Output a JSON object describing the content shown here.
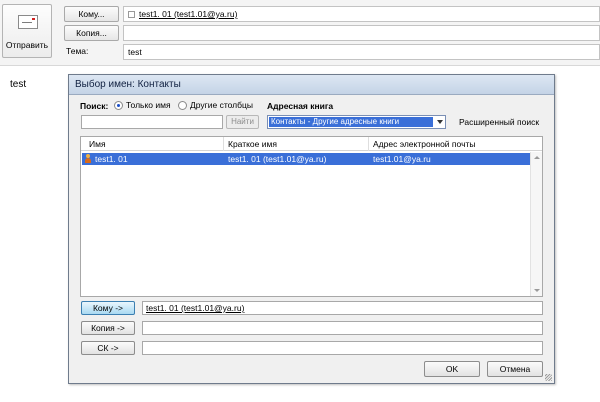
{
  "compose": {
    "send_label": "Отправить",
    "to_button": "Кому...",
    "to_value": "test1. 01 (test1.01@ya.ru)",
    "cc_button": "Копия...",
    "cc_value": "",
    "subject_label": "Тема:",
    "subject_value": "test",
    "body": "test"
  },
  "dialog": {
    "title": "Выбор имен: Контакты",
    "search_label": "Поиск:",
    "radio_name_only": "Только имя",
    "radio_other_columns": "Другие столбцы",
    "address_book_label": "Адресная книга",
    "search_value": "",
    "find_button": "Найти",
    "address_book_value": "Контакты - Другие адресные книги",
    "advanced_search": "Расширенный поиск",
    "columns": [
      "Имя",
      "Краткое имя",
      "Адрес электронной почты"
    ],
    "rows": [
      {
        "name": "test1. 01",
        "display": "test1. 01 (test1.01@ya.ru)",
        "email": "test1.01@ya.ru"
      }
    ],
    "to_button": "Кому ->",
    "to_value": "test1. 01 (test1.01@ya.ru)",
    "cc_button": "Копия ->",
    "cc_value": "",
    "bcc_button": "СК ->",
    "bcc_value": "",
    "ok_button": "OK",
    "cancel_button": "Отмена"
  },
  "colors": {
    "selection": "#3a6fd8",
    "title_bar": "#c4d3e6",
    "active_button": "#a9d9f2"
  },
  "icons": [
    "envelope-send-icon",
    "contact-person-icon",
    "dropdown-arrow-icon",
    "scroll-up-icon",
    "scroll-down-icon",
    "resize-grip-icon"
  ]
}
